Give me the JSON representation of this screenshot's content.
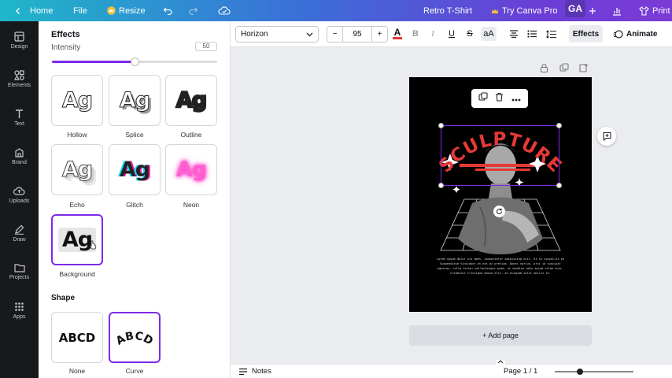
{
  "topbar": {
    "home": "Home",
    "file": "File",
    "resize": "Resize",
    "doc_title": "Retro T-Shirt",
    "try_pro": "Try Canva Pro",
    "avatar": "GA",
    "print": "Print"
  },
  "rail": {
    "items": [
      {
        "label": "Design",
        "icon": "layout-icon"
      },
      {
        "label": "Elements",
        "icon": "shapes-icon"
      },
      {
        "label": "Text",
        "icon": "text-icon"
      },
      {
        "label": "Brand",
        "icon": "brand-icon"
      },
      {
        "label": "Uploads",
        "icon": "cloud-upload-icon"
      },
      {
        "label": "Draw",
        "icon": "pen-icon"
      },
      {
        "label": "Projects",
        "icon": "folder-icon"
      },
      {
        "label": "Apps",
        "icon": "grid-icon"
      }
    ]
  },
  "panel": {
    "title": "Effects",
    "intensity_label": "Intensity",
    "intensity_value": "50",
    "intensity_fraction": 0.5,
    "styles": [
      {
        "label": "Hollow"
      },
      {
        "label": "Splice"
      },
      {
        "label": "Outline"
      },
      {
        "label": "Echo"
      },
      {
        "label": "Glitch"
      },
      {
        "label": "Neon"
      },
      {
        "label": "Background"
      }
    ],
    "sample_text": "Ag",
    "shape_heading": "Shape",
    "shapes": [
      {
        "label": "None",
        "sample": "ABCD"
      },
      {
        "label": "Curve",
        "sample": "ABCD"
      }
    ]
  },
  "toolbar": {
    "font": "Horizon",
    "font_size": "95",
    "minus": "−",
    "plus": "+",
    "effects": "Effects",
    "animate": "Animate",
    "text_color": "#e53935"
  },
  "canvas": {
    "headline": "SCULPTURE",
    "body_lines": [
      "Lorem ipsum dolor sit amet, consectetur adipiscing elit. Ut in convallis ex",
      "Suspendisse tincidunt at est ac pretium. Donec varius, orci id suscipit",
      "egestas, nulla tortor pellentesque quam, ut sodales odio ipsum vitae nunc.",
      "Curabitur tristique massa elit, ac aliquam velit mollis in."
    ],
    "add_page": "+ Add page"
  },
  "footer": {
    "notes": "Notes",
    "page_counter": "Page 1 / 1"
  },
  "colors": {
    "accent": "#7d2ae8",
    "headline_red": "#e53935"
  }
}
